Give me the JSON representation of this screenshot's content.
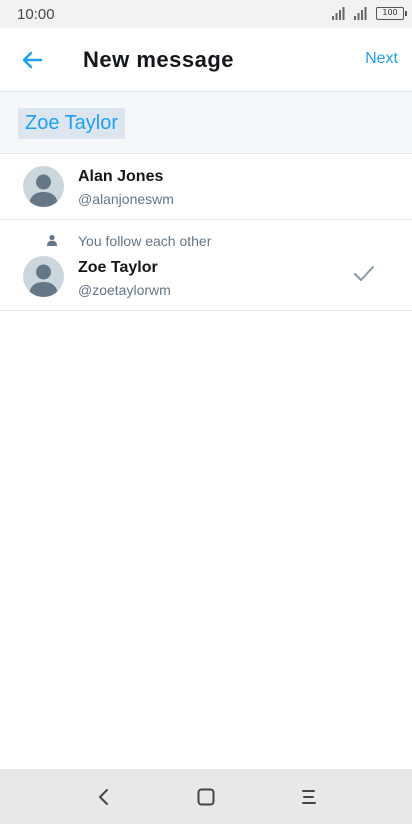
{
  "status_bar": {
    "time": "10:00",
    "battery": "100",
    "icons": [
      "signal-icon",
      "signal-icon",
      "battery-icon"
    ]
  },
  "header": {
    "back_icon": "arrow-left-icon",
    "title": "New message",
    "next_label": "Next"
  },
  "recipients": {
    "selected": [
      "Zoe Taylor"
    ]
  },
  "users": [
    {
      "name": "Alan Jones",
      "handle": "@alanjoneswm",
      "follow_note": "",
      "selected": false
    },
    {
      "name": "Zoe Taylor",
      "handle": "@zoetaylorwm",
      "follow_note": "You follow each other",
      "selected": true
    }
  ],
  "nav_bar": {
    "icons": [
      "back-icon",
      "home-icon",
      "menu-icon"
    ]
  },
  "colors": {
    "accent": "#1da1f2",
    "text_primary": "#14171a",
    "text_secondary": "#657786",
    "divider": "#e1e8ed",
    "chip_bg": "#dde6ee"
  }
}
